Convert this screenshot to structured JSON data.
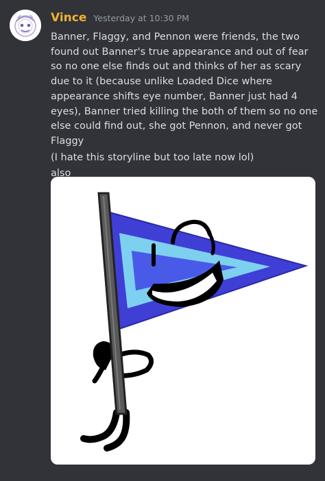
{
  "message": {
    "author": "Vince",
    "timestamp": "Yesterday at 10:30 PM",
    "paragraphs": [
      "Banner, Flaggy, and Pennon were friends, the two found out Banner's true appearance and out of fear so no one else finds out and thinks of her as scary due to it (because unlike Loaded Dice where appearance shifts eye number, Banner just had 4 eyes), Banner tried killing the both of them so no one else could find out, she got Pennon, and never got Flaggy",
      "(I hate this storyline but too late now lol)",
      "also"
    ],
    "username_color": "#f0b232"
  },
  "attachment": {
    "subject": "cartoon pennant flag character with a smiling face",
    "colors": {
      "flag_outer": "#3f3fd6",
      "flag_inner": "#7ed0f0",
      "pole": "#595959"
    }
  }
}
